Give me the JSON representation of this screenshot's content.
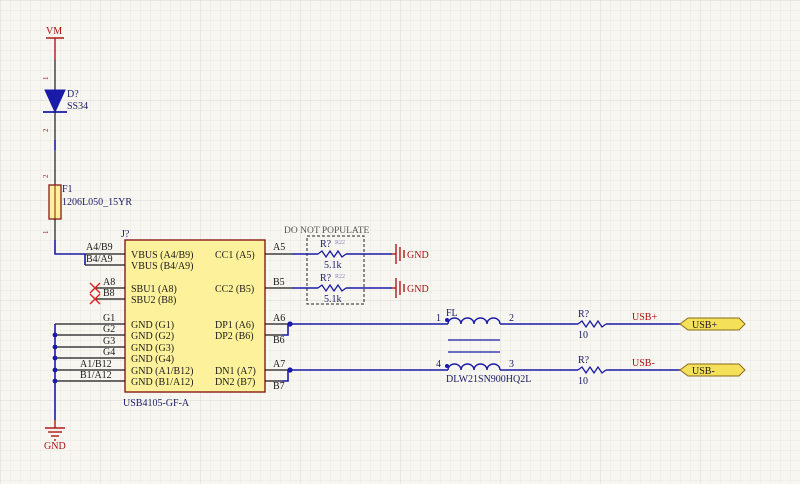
{
  "power": {
    "vm": "VM",
    "gnd_left": "GND",
    "gnd_cc1": "GND",
    "gnd_cc2": "GND"
  },
  "diode": {
    "ref": "D?",
    "value": "SS34",
    "pin1": "1",
    "pin2": "2"
  },
  "fuse": {
    "ref": "F1",
    "value": "1206L050_15YR",
    "pin1": "1",
    "pin2": "2"
  },
  "connector": {
    "ref": "J?",
    "part": "USB4105-GF-A",
    "left_pins": [
      {
        "num": "A4/B9",
        "name": "VBUS (A4/B9)"
      },
      {
        "num": "B4/A9",
        "name": "VBUS (B4/A9)"
      },
      {
        "num": "A8",
        "name": "SBU1 (A8)"
      },
      {
        "num": "B8",
        "name": "SBU2 (B8)"
      },
      {
        "num": "G1",
        "name": "GND (G1)"
      },
      {
        "num": "G2",
        "name": "GND (G2)"
      },
      {
        "num": "G3",
        "name": "GND (G3)"
      },
      {
        "num": "G4",
        "name": "GND (G4)"
      },
      {
        "num": "A1/B12",
        "name": "GND (A1/B12)"
      },
      {
        "num": "B1/A12",
        "name": "GND (B1/A12)"
      }
    ],
    "right_pins": [
      {
        "num": "A5",
        "name": "CC1 (A5)"
      },
      {
        "num": "B5",
        "name": "CC2 (B5)"
      },
      {
        "num": "A6",
        "name": "DP1 (A6)"
      },
      {
        "num": "B6",
        "name": "DP2 (B6)"
      },
      {
        "num": "A7",
        "name": "DN1 (A7)"
      },
      {
        "num": "B7",
        "name": "DN2 (B7)"
      }
    ]
  },
  "dnp": {
    "label": "DO NOT POPULATE"
  },
  "cc_resistors": [
    {
      "ref": "R?",
      "value": "5.1k",
      "tag": "R22"
    },
    {
      "ref": "R?",
      "value": "5.1k",
      "tag": "R22"
    }
  ],
  "choke": {
    "ref": "FL",
    "part": "DLW21SN900HQ2L",
    "p1": "1",
    "p2": "2",
    "p3": "3",
    "p4": "4"
  },
  "series_resistors": [
    {
      "ref": "R?",
      "value": "10"
    },
    {
      "ref": "R?",
      "value": "10"
    }
  ],
  "nets": {
    "usb_p": "USB+",
    "usb_n": "USB-"
  },
  "ports": {
    "usb_p": "USB+",
    "usb_n": "USB-"
  },
  "colors": {
    "wire": "#1a1aa8",
    "body": "#fdf29b",
    "port": "#f5e05a",
    "power": "#b01818",
    "grid": "#e2e1da"
  }
}
